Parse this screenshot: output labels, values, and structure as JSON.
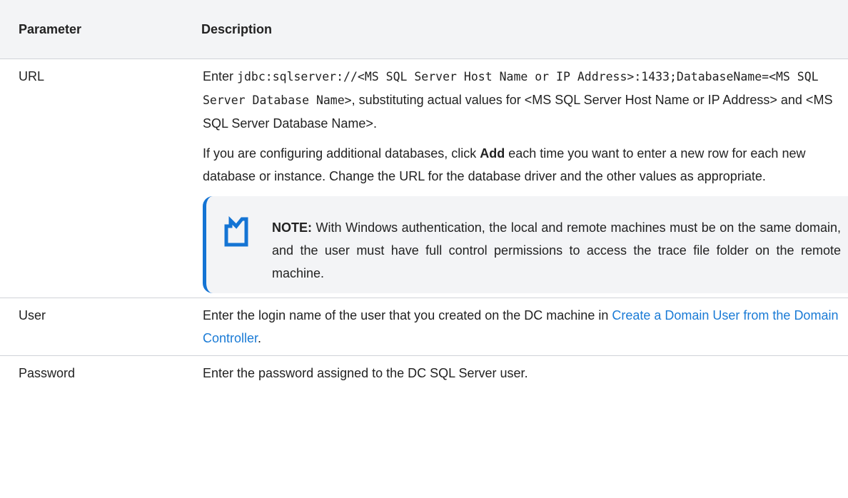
{
  "table": {
    "headers": {
      "parameter": "Parameter",
      "description": "Description"
    },
    "rows": {
      "url": {
        "parameter": "URL",
        "p1_enter": "Enter ",
        "p1_code": "jdbc:sqlserver://<MS SQL Server Host Name or IP Address>:1433;DatabaseName=<MS SQL Server Database Name>",
        "p1_rest": ", substituting actual values for <MS SQL Server Host Name or IP Address> and <MS SQL Server Database Name>.",
        "p2_before": "If you are configuring additional databases, click ",
        "p2_bold": "Add",
        "p2_after": " each time you want to enter a new row for each new database or instance. Change the URL for the database driver and the other values as appropriate.",
        "note_label": "NOTE:",
        "note_text": " With Windows authentication, the local and remote machines must be on the same domain, and the user must have full control permissions to access the trace file folder on the remote machine."
      },
      "user": {
        "parameter": "User",
        "desc_before": "Enter the login name of the user that you created on the DC machine in ",
        "desc_link": "Create a Domain User from the Domain Controller",
        "desc_after": "."
      },
      "password": {
        "parameter": "Password",
        "desc": "Enter the password assigned to the DC SQL Server user."
      }
    }
  },
  "colors": {
    "accent": "#1474d4",
    "link": "#1a7bd6",
    "header_bg": "#f3f4f6",
    "note_bg": "#f3f4f6"
  },
  "icons": {
    "note": "note-icon"
  }
}
